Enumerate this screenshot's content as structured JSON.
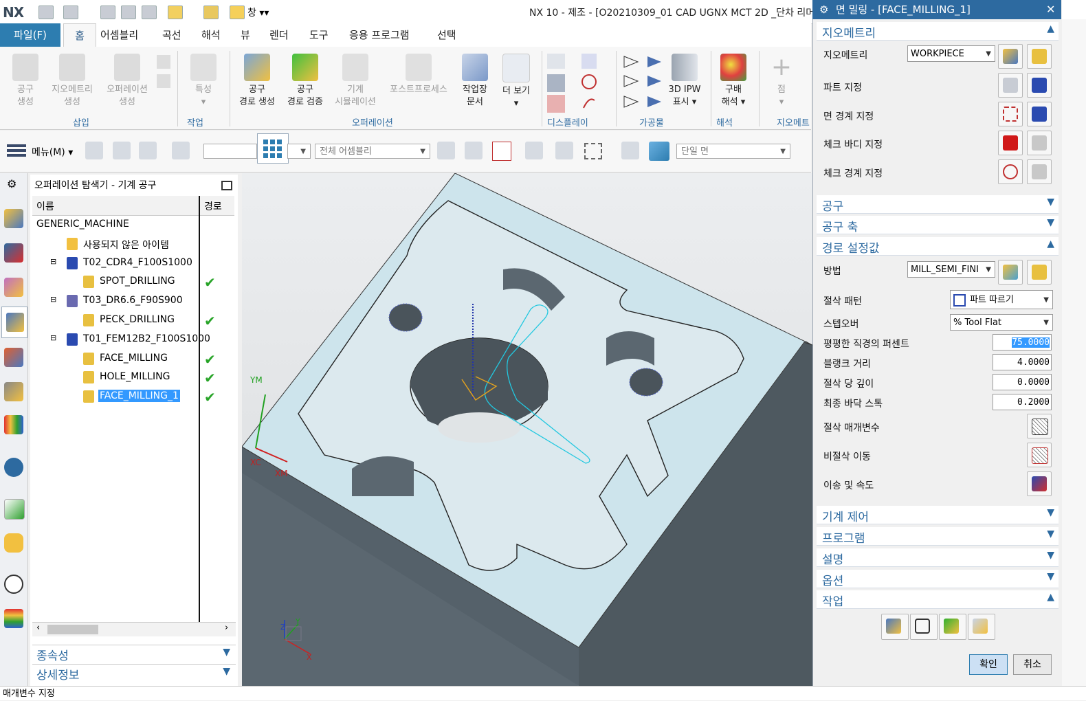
{
  "app": {
    "logo": "NX",
    "window_title": "NX 10 - 제조 - [O20210309_01 CAD UGNX MCT 2D _단차 리머",
    "quick_access": {
      "window_label": "창"
    }
  },
  "menu": {
    "file_label": "파일(F)",
    "tabs": [
      "홈",
      "어셈블리",
      "곡선",
      "해석",
      "뷰",
      "렌더",
      "도구",
      "응용 프로그램",
      "선택"
    ],
    "active_tab": "홈"
  },
  "ribbon": {
    "buttons": [
      {
        "l1": "공구",
        "l2": "생성",
        "disabled": true
      },
      {
        "l1": "지오메트리",
        "l2": "생성",
        "disabled": true
      },
      {
        "l1": "오퍼레이션",
        "l2": "생성",
        "disabled": true
      },
      {
        "l1": "특성",
        "l2": "▾",
        "disabled": true
      },
      {
        "l1": "공구",
        "l2": "경로 생성",
        "disabled": false
      },
      {
        "l1": "공구",
        "l2": "경로 검증",
        "disabled": false
      },
      {
        "l1": "기계",
        "l2": "시뮬레이션",
        "disabled": true
      },
      {
        "l1": "포스트프로세스",
        "l2": "",
        "disabled": true
      },
      {
        "l1": "작업장",
        "l2": "문서",
        "disabled": false
      },
      {
        "l1": "더 보기",
        "l2": "▾",
        "disabled": false
      },
      {
        "l1": "3D IPW",
        "l2": "표시 ▾",
        "disabled": false
      },
      {
        "l1": "구배",
        "l2": "해석 ▾",
        "disabled": false
      },
      {
        "l1": "점",
        "l2": "▾",
        "disabled": true
      }
    ],
    "groups": [
      "삽입",
      "작업",
      "오퍼레이션",
      "디스플레이",
      "가공물",
      "해석",
      "지오메트"
    ]
  },
  "toolbar": {
    "menu_label": "메뉴(M)",
    "assembly_filter": "전체 어셈블리",
    "face_filter": "단일 면"
  },
  "navigator": {
    "title": "오퍼레이션 탐색기 - 기계 공구",
    "col_name": "이름",
    "col_path": "경로",
    "rows": [
      {
        "label": "GENERIC_MACHINE",
        "indent": 0,
        "check": ""
      },
      {
        "label": "사용되지 않은 아이템",
        "indent": 1,
        "check": ""
      },
      {
        "label": "T02_CDR4_F100S1000",
        "indent": 1,
        "check": ""
      },
      {
        "label": "SPOT_DRILLING",
        "indent": 2,
        "check": "✔"
      },
      {
        "label": "T03_DR6.6_F90S900",
        "indent": 1,
        "check": ""
      },
      {
        "label": "PECK_DRILLING",
        "indent": 2,
        "check": "✔"
      },
      {
        "label": "T01_FEM12B2_F100S1000",
        "indent": 1,
        "check": ""
      },
      {
        "label": "FACE_MILLING",
        "indent": 2,
        "check": "✔"
      },
      {
        "label": "HOLE_MILLING",
        "indent": 2,
        "check": "✔"
      },
      {
        "label": "FACE_MILLING_1",
        "indent": 2,
        "check": "✔",
        "selected": true
      }
    ],
    "bottom_sections": [
      "종속성",
      "상세정보"
    ]
  },
  "viewport": {
    "axis_labels": {
      "ym": "YM",
      "xc": "XC",
      "xm": "XM",
      "x": "X",
      "y": "Y",
      "z": "Z"
    }
  },
  "dialog": {
    "title": "면 밀링 - [FACE_MILLING_1]",
    "geometry": {
      "header": "지오메트리",
      "geometry_label": "지오메트리",
      "geometry_value": "WORKPIECE",
      "rows": [
        "파트 지정",
        "면 경계 지정",
        "체크 바디 지정",
        "체크 경계 지정"
      ]
    },
    "tool_header": "공구",
    "tool_axis_header": "공구 축",
    "path": {
      "header": "경로 설정값",
      "method_label": "방법",
      "method_value": "MILL_SEMI_FINI",
      "pattern_label": "절삭 패턴",
      "pattern_value": "파트 따르기",
      "stepover_label": "스텝오버",
      "stepover_value": "% Tool Flat",
      "flat_pct_label": "평평한 직경의 퍼센트",
      "flat_pct_value": "75.0000",
      "blank_label": "블랭크 거리",
      "blank_value": "4.0000",
      "depth_label": "절삭 당 깊이",
      "depth_value": "0.0000",
      "floor_label": "최종 바닥 스톡",
      "floor_value": "0.2000",
      "cut_params": "절삭 매개변수",
      "non_cut": "비절삭 이동",
      "feeds": "이송 및 속도"
    },
    "machine_control": "기계 제어",
    "program": "프로그램",
    "description": "설명",
    "options": "옵션",
    "actions": "작업",
    "ok": "확인",
    "cancel": "취소"
  },
  "status": {
    "text": "매개변수 지정"
  },
  "colors": {
    "accent": "#2d6aa0",
    "file_tab": "#2d7db0",
    "selection": "#3399ff",
    "part_face": "#cde4ec",
    "part_side": "#5b6770",
    "toolpath": "#22c8e0"
  }
}
